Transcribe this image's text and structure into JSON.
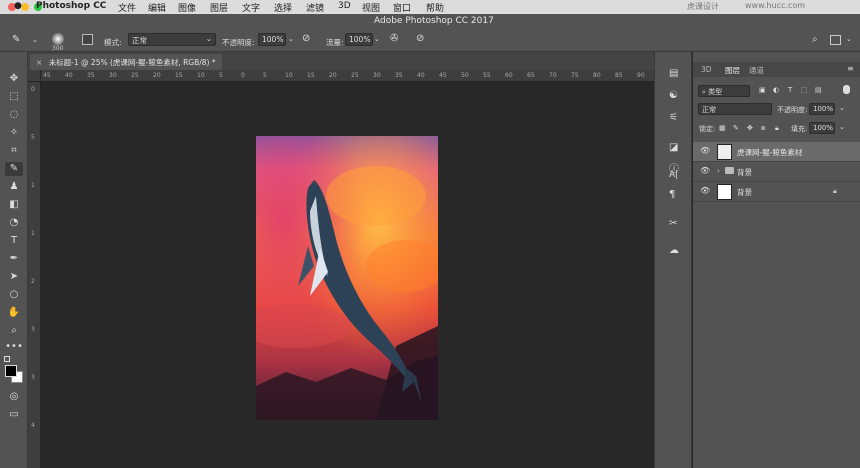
{
  "menubar": {
    "app": "Photoshop CC",
    "items": [
      "文件",
      "编辑",
      "图像",
      "图层",
      "文字",
      "选择",
      "滤镜",
      "3D",
      "视图",
      "窗口",
      "帮助"
    ],
    "window_title": "Adobe Photoshop CC 2017",
    "watermark": "虎课设计",
    "watermark_url": "www.hucc.com"
  },
  "options": {
    "brush_size": "300",
    "mode_label": "模式:",
    "mode_value": "正常",
    "opacity_label": "不透明度:",
    "opacity_value": "100%",
    "flow_label": "流量:",
    "flow_value": "100%"
  },
  "document": {
    "tab_title": "未标题-1 @ 25% (虎课网-鲲-鲸鱼素材, RGB/8) *"
  },
  "rulers": {
    "h": [
      "45",
      "40",
      "35",
      "30",
      "25",
      "20",
      "15",
      "10",
      "5",
      "0",
      "5",
      "10",
      "15",
      "20",
      "25",
      "30",
      "35",
      "40",
      "45",
      "50",
      "55",
      "60",
      "65",
      "70",
      "75",
      "80",
      "85",
      "90"
    ],
    "v": [
      "0",
      "5",
      "1",
      "1",
      "2",
      "3",
      "3",
      "4"
    ]
  },
  "panel_tabs": [
    "3D",
    "图层",
    "通道"
  ],
  "layers": {
    "filter_label": "类型",
    "blend_mode": "正常",
    "opacity_label": "不透明度:",
    "opacity_value": "100%",
    "lock_label": "锁定:",
    "fill_label": "填充:",
    "fill_value": "100%",
    "items": [
      {
        "name": "虎课网-鲲-鲸鱼素材"
      },
      {
        "name": "背景"
      },
      {
        "name": "背景"
      }
    ]
  },
  "colors": {
    "accent": "#535353",
    "canvas_bg": "#282828"
  }
}
